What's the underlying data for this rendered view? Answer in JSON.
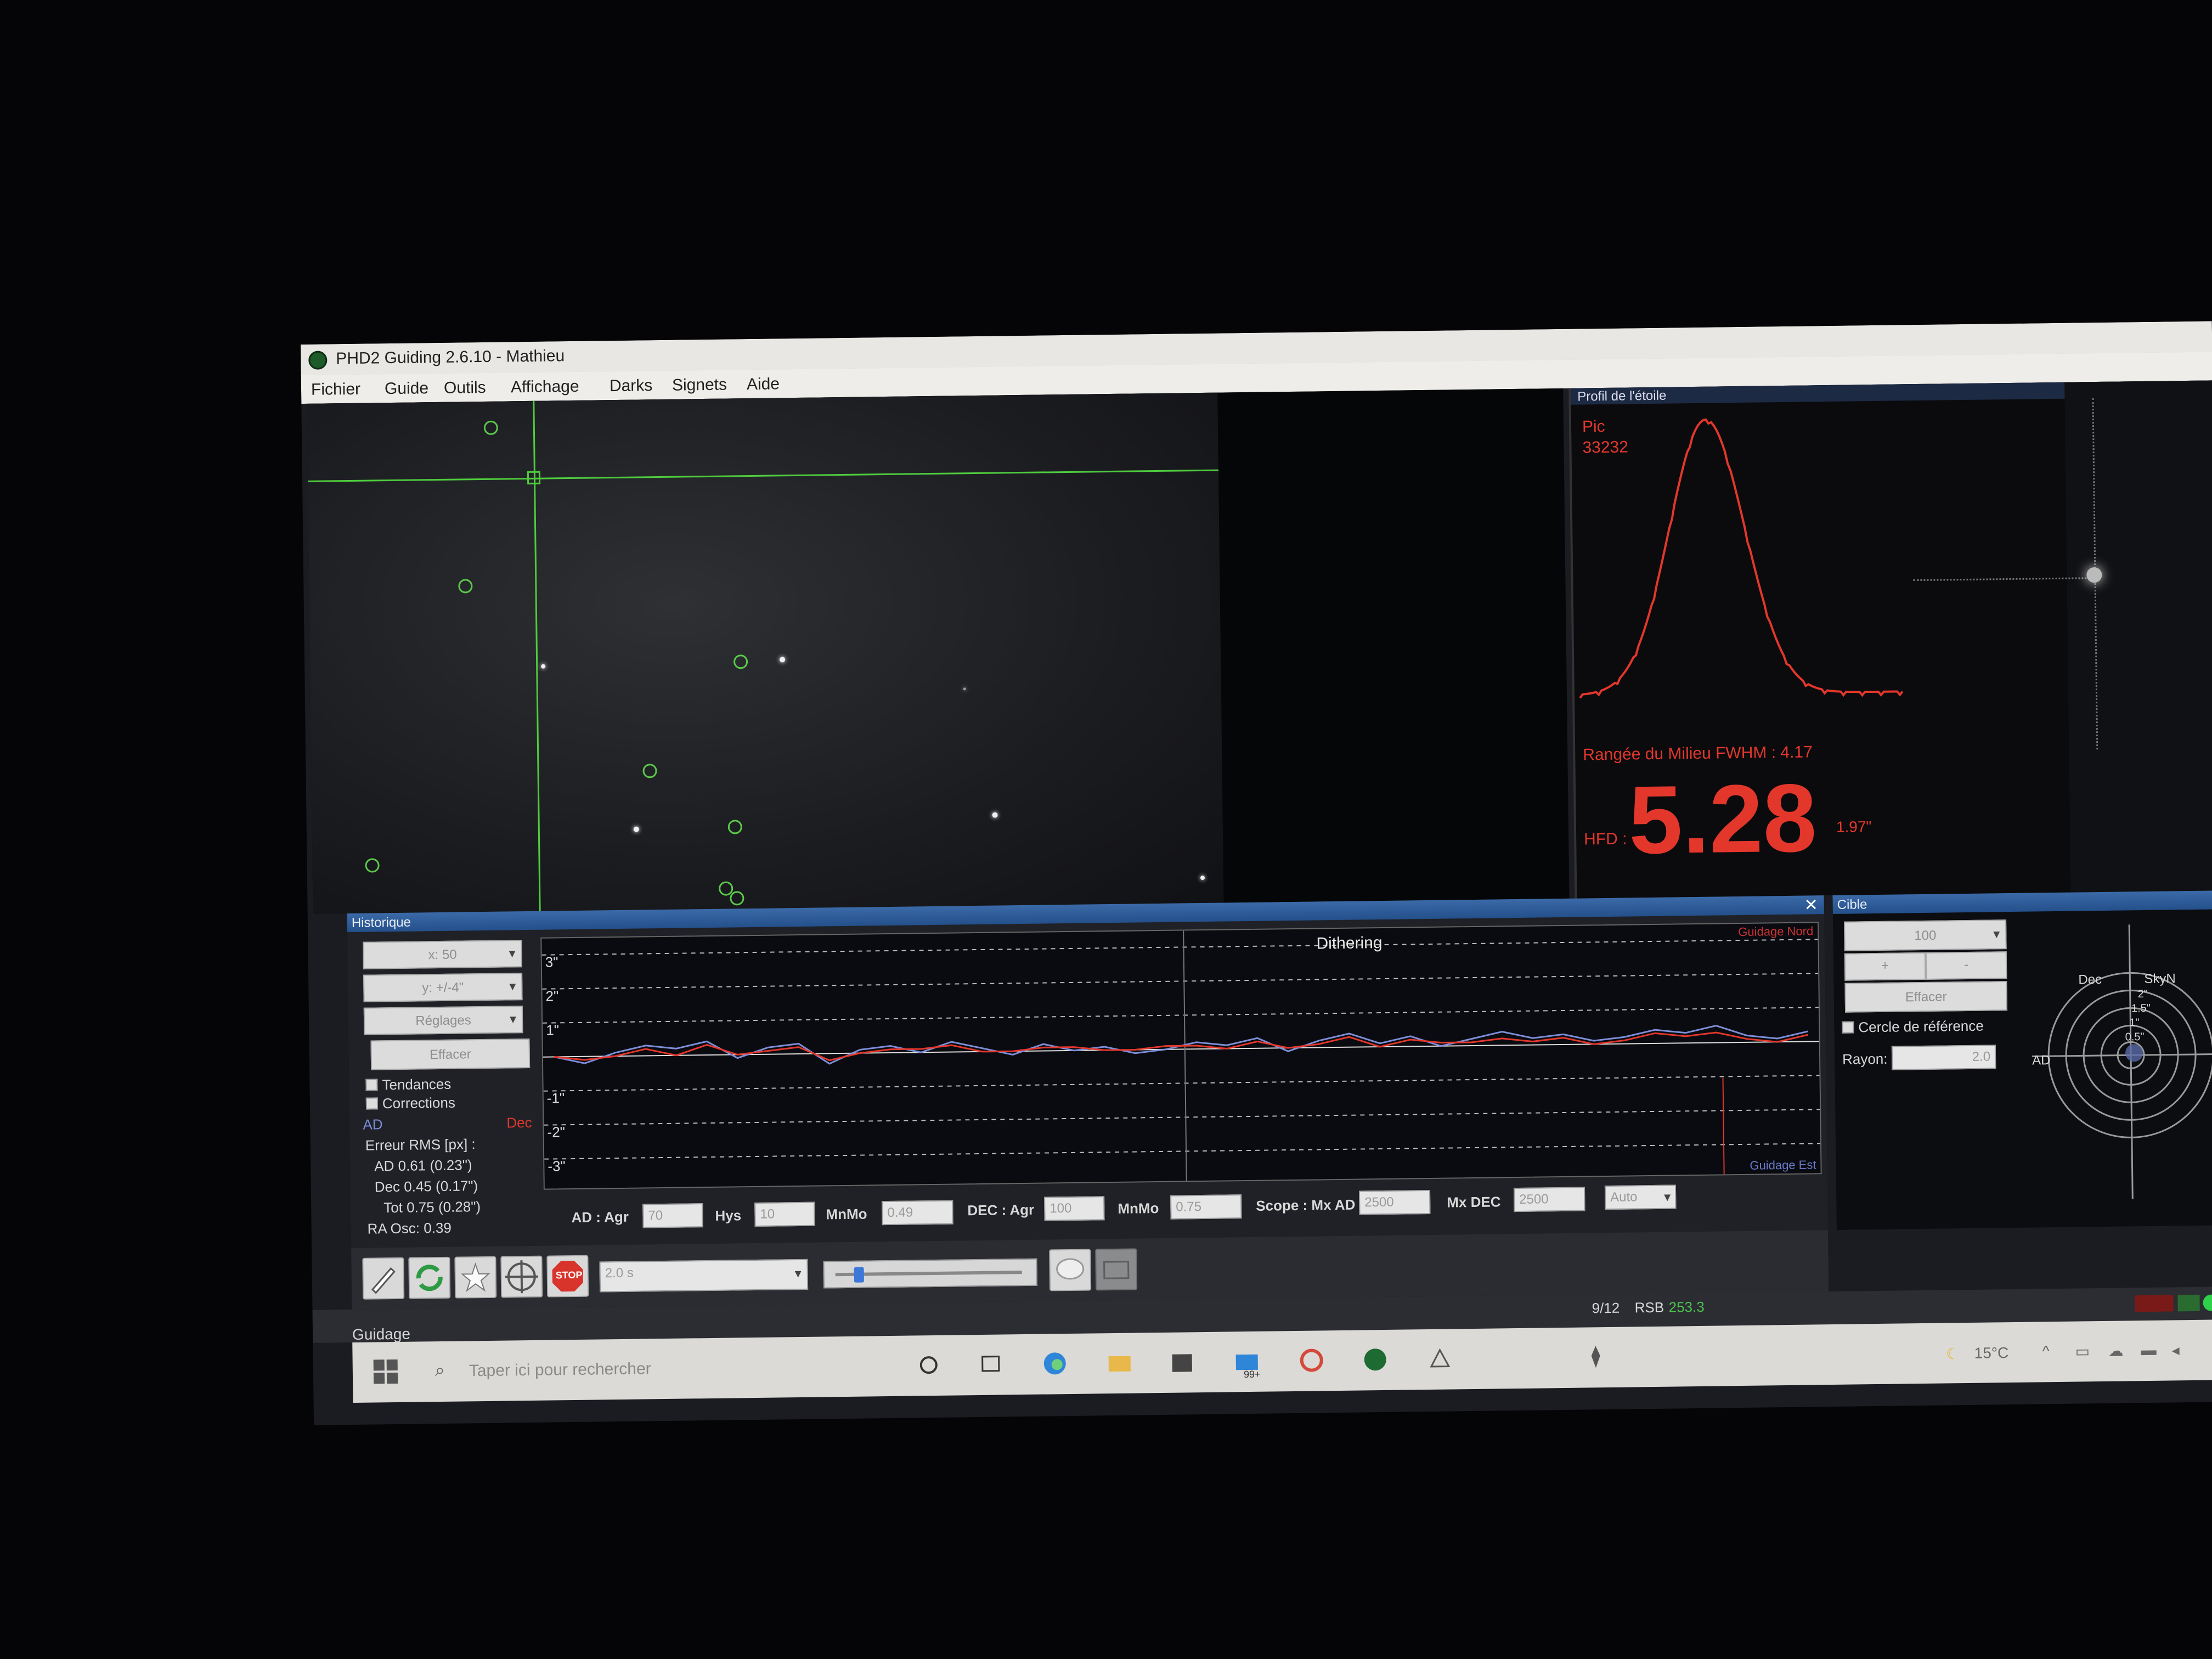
{
  "window": {
    "title": "PHD2 Guiding 2.6.10 - Mathieu"
  },
  "menu": [
    "Fichier",
    "Guide",
    "Outils",
    "Affichage",
    "Darks",
    "Signets",
    "Aide"
  ],
  "profile": {
    "title": "Profil de l'étoile",
    "peak_label": "Pic",
    "peak_value": "33232",
    "fwhm_label": "Rangée du Milieu FWHM : 4.17",
    "hfd_label": "HFD :",
    "hfd_value": "5.28",
    "hfd_arcsec": "1.97\""
  },
  "history": {
    "title": "Historique",
    "x_select": "x: 50",
    "y_select": "y: +/-4\"",
    "settings": "Réglages",
    "clear": "Effacer",
    "trends": "Tendances",
    "corrections": "Corrections",
    "legend_ra": "AD",
    "legend_dec": "Dec",
    "rms_title": "Erreur RMS [px] :",
    "rms_ra": "AD 0.61 (0.23\")",
    "rms_dec": "Dec 0.45 (0.17\")",
    "rms_tot": "Tot 0.75 (0.28\")",
    "ra_osc": "RA Osc: 0.39",
    "dithering": "Dithering",
    "guide_north": "Guidage Nord",
    "guide_east": "Guidage Est",
    "y_ticks": [
      "3\"",
      "2\"",
      "1\"",
      "-1\"",
      "-2\"",
      "-3\""
    ]
  },
  "params": {
    "ad_agr_label": "AD : Agr",
    "ad_agr": "70",
    "hys_label": "Hys",
    "hys": "10",
    "mnmo_label": "MnMo",
    "mnmo_ra": "0.49",
    "dec_agr_label": "DEC : Agr",
    "dec_agr": "100",
    "mnmo2_label": "MnMo",
    "mnmo_dec": "0.75",
    "scope_label": "Scope : Mx AD",
    "mx_ad": "2500",
    "mxdec_label": "Mx DEC",
    "mx_dec": "2500",
    "mode": "Auto"
  },
  "target": {
    "title": "Cible",
    "zoom": "100",
    "plus": "+",
    "minus": "-",
    "clear": "Effacer",
    "ref_circle": "Cercle de référence",
    "radius_label": "Rayon:",
    "radius": "2.0",
    "dec_label": "Dec",
    "sky_label": "SkyN",
    "ad_label": "AD",
    "ticks": [
      "2\"",
      "1.5\"",
      "1\"",
      "0.5\""
    ]
  },
  "toolbar": {
    "exposure": "2.0 s",
    "stop_label": "STOP"
  },
  "status": {
    "frames": "9/12",
    "snr_label": "RSB",
    "snr_value": "253.3",
    "mode": "Guidage"
  },
  "taskbar": {
    "search_placeholder": "Taper ici pour rechercher",
    "temp": "15°C",
    "badge": "99+"
  },
  "graph_series": {
    "ra": [
      0,
      -0.2,
      0.1,
      0.3,
      0.2,
      0.4,
      -0.1,
      0.2,
      0.3,
      -0.3,
      0.1,
      0.2,
      0.0,
      0.3,
      0.1,
      -0.1,
      0.2,
      0.0,
      0.1,
      -0.1,
      0.0,
      0.2,
      0.1,
      0.3,
      -0.1,
      0.2,
      0.4,
      0.1,
      0.3,
      0.0,
      0.2,
      0.4,
      0.2,
      0.3,
      0.1,
      0.2,
      0.4,
      0.3,
      0.5,
      0.2,
      0.1,
      0.3
    ],
    "dec": [
      0,
      -0.1,
      0.0,
      0.2,
      0.0,
      0.3,
      0.0,
      0.1,
      0.2,
      -0.2,
      0.0,
      0.1,
      0.1,
      0.2,
      0.0,
      0.0,
      0.1,
      0.1,
      0.0,
      0.0,
      0.1,
      0.1,
      0.0,
      0.2,
      0.0,
      0.1,
      0.3,
      0.0,
      0.2,
      0.1,
      0.1,
      0.2,
      0.1,
      0.2,
      0.0,
      0.1,
      0.3,
      0.2,
      0.3,
      0.1,
      0.0,
      0.2
    ]
  },
  "colors": {
    "ra": "#7d8ed8",
    "dec": "#e3372c",
    "accent": "#25477a",
    "crosshair": "#4fcc3e"
  }
}
